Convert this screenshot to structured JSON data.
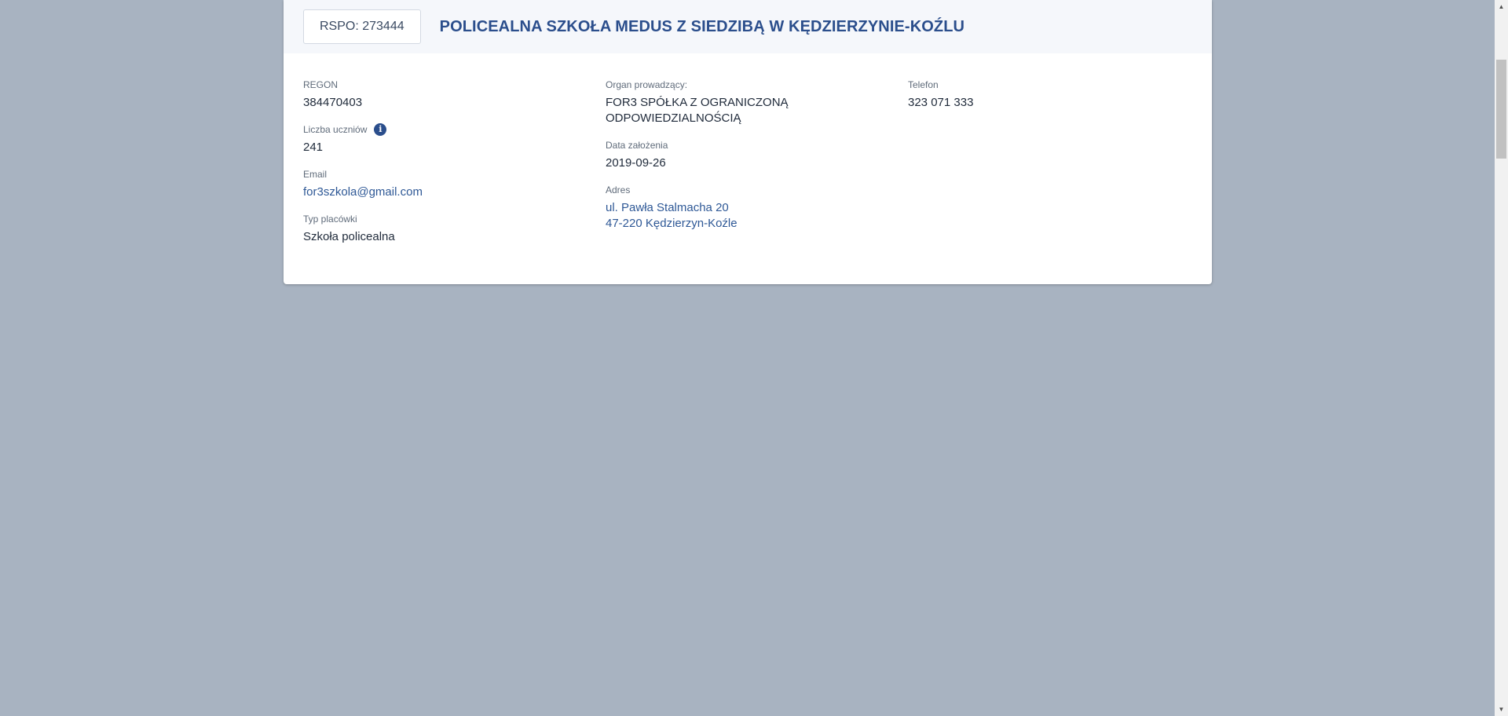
{
  "header": {
    "rspo": "RSPO: 273444",
    "school_name": "POLICEALNA SZKOŁA MEDUS Z SIEDZIBĄ W KĘDZIERZYNIE-KOŹLU"
  },
  "details": {
    "regon": {
      "label": "REGON",
      "value": "384470403"
    },
    "students": {
      "label": "Liczba uczniów",
      "value": "241"
    },
    "email": {
      "label": "Email",
      "value": "for3szkola@gmail.com"
    },
    "type": {
      "label": "Typ placówki",
      "value": "Szkoła policealna"
    },
    "organ": {
      "label": "Organ prowadzący:",
      "line1": "FOR3 SPÓŁKA Z OGRANICZONĄ",
      "line2": "ODPOWIEDZIALNOŚCIĄ"
    },
    "founded": {
      "label": "Data założenia",
      "value": "2019-09-26"
    },
    "address": {
      "label": "Adres",
      "line1": "ul. Pawła Stalmacha 20",
      "line2": "47-220 Kędzierzyn-Koźle"
    },
    "phone": {
      "label": "Telefon",
      "value": "323 071 333"
    }
  },
  "icons": {
    "info": "info-icon",
    "scroll_up": "chevron-up-icon",
    "scroll_down": "chevron-down-icon"
  },
  "colors": {
    "background": "#a8b3c1",
    "accent": "#2b4e8c",
    "link": "#2e5896"
  }
}
